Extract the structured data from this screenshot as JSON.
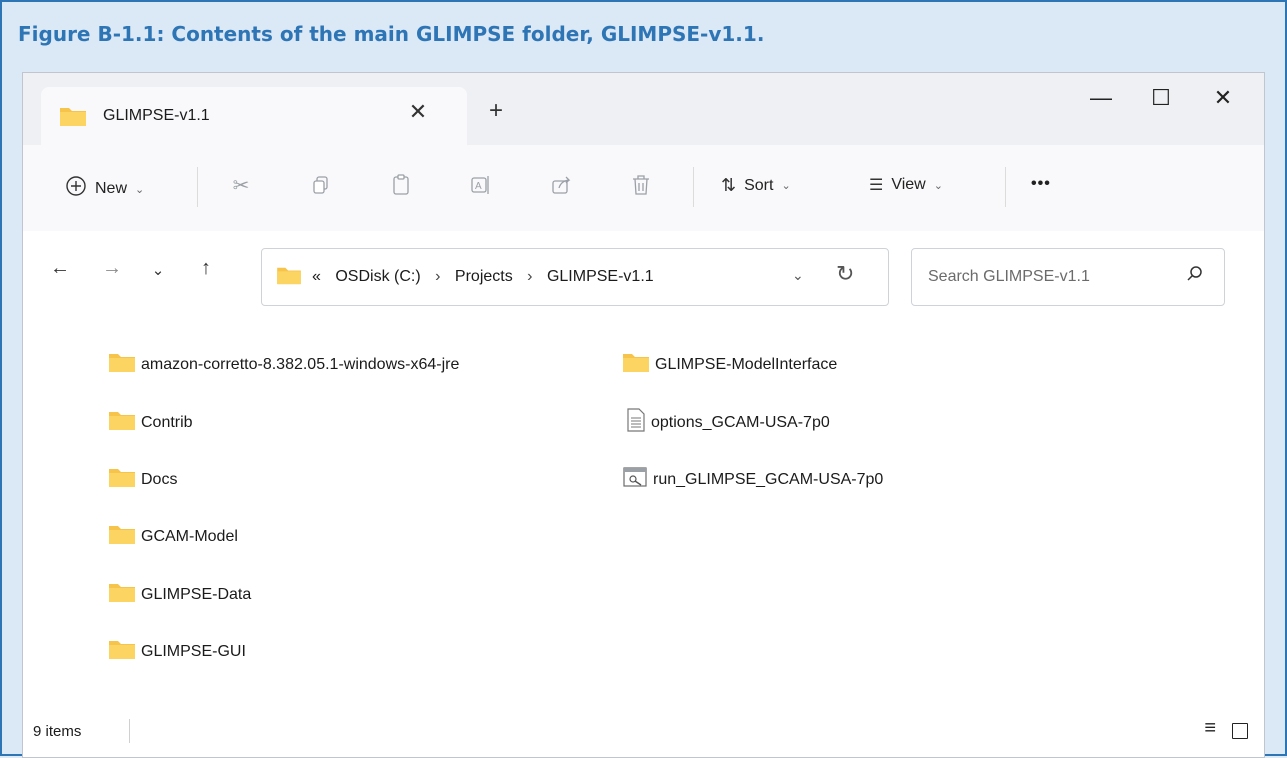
{
  "caption": "Figure B-1.1: Contents of the main GLIMPSE folder, GLIMPSE-v1.1.",
  "window": {
    "tab_title": "GLIMPSE-v1.1",
    "tab_close": "✕",
    "new_tab": "+",
    "minimize": "—",
    "maximize": "☐",
    "close": "✕"
  },
  "toolbar": {
    "new_label": "New",
    "sort_label": "Sort",
    "view_label": "View",
    "more_label": "•••"
  },
  "address": {
    "overflow": "«",
    "crumbs": [
      "OSDisk (C:)",
      "Projects",
      "GLIMPSE-v1.1"
    ],
    "separator": "›"
  },
  "search": {
    "placeholder": "Search GLIMPSE-v1.1"
  },
  "files": {
    "col1": [
      "amazon-corretto-8.382.05.1-windows-x64-jre",
      "Contrib",
      "Docs",
      "GCAM-Model",
      "GLIMPSE-Data",
      "GLIMPSE-GUI"
    ],
    "col2_folder": "GLIMPSE-ModelInterface",
    "col2_text": "options_GCAM-USA-7p0",
    "col2_script": "run_GLIMPSE_GCAM-USA-7p0"
  },
  "status": {
    "count": "9 items"
  },
  "colors": {
    "caption": "#2e75b6",
    "folder": "#f7c44b",
    "frame_bg": "#dbe8f5"
  }
}
